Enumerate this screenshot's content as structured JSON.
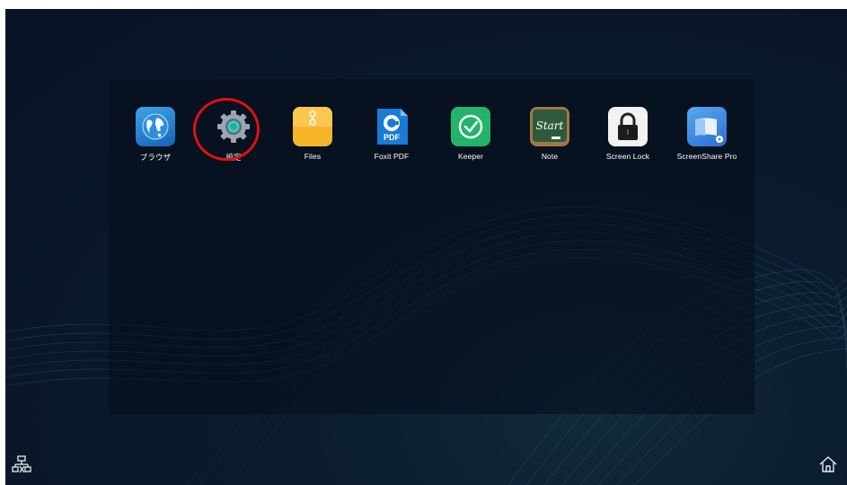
{
  "apps": [
    {
      "label": "ブラウザ",
      "icon": "globe-icon"
    },
    {
      "label": "設定",
      "icon": "gear-icon"
    },
    {
      "label": "Files",
      "icon": "folder-icon"
    },
    {
      "label": "Foxit PDF",
      "icon": "foxit-pdf-icon"
    },
    {
      "label": "Keeper",
      "icon": "keeper-icon"
    },
    {
      "label": "Note",
      "icon": "chalkboard-icon",
      "icon_text": "Start"
    },
    {
      "label": "Screen Lock",
      "icon": "padlock-icon"
    },
    {
      "label": "ScreenShare Pro",
      "icon": "screenshare-icon"
    }
  ],
  "system": {
    "network_icon": "network-disconnected-icon",
    "home_icon": "home-icon"
  },
  "colors": {
    "background": "#0b1a2e",
    "highlight": "#e01010",
    "files_yellow": "#f7b52b",
    "keeper_green": "#22b46b",
    "foxit_blue": "#1a7ad6"
  }
}
